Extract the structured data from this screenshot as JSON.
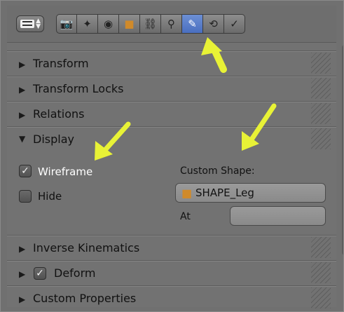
{
  "header": {
    "tabs": [
      {
        "name": "render"
      },
      {
        "name": "scene"
      },
      {
        "name": "world"
      },
      {
        "name": "object"
      },
      {
        "name": "constraints"
      },
      {
        "name": "data"
      },
      {
        "name": "bone",
        "active": true
      },
      {
        "name": "bone-constraints"
      },
      {
        "name": "modifier"
      }
    ]
  },
  "panels": {
    "transform": "Transform",
    "transform_locks": "Transform Locks",
    "relations": "Relations",
    "display": "Display",
    "inverse_kinematics": "Inverse Kinematics",
    "deform": "Deform",
    "custom_properties": "Custom Properties"
  },
  "display": {
    "wireframe_label": "Wireframe",
    "wireframe_checked": true,
    "hide_label": "Hide",
    "hide_checked": false,
    "custom_shape_label": "Custom Shape:",
    "custom_shape_value": "SHAPE_Leg",
    "at_label": "At",
    "at_value": ""
  },
  "deform_checked": true,
  "colors": {
    "annotation_arrow": "#e8f236",
    "active_tab": "#5a7fd0"
  }
}
